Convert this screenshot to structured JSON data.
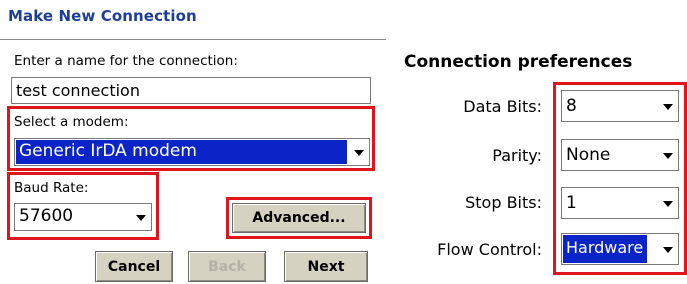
{
  "dialog": {
    "title": "Make New Connection",
    "name_prompt": "Enter a name for the connection:",
    "name_value": "test connection",
    "modem_label": "Select a modem:",
    "modem_value": "Generic IrDA modem",
    "baud_label": "Baud Rate:",
    "baud_value": "57600",
    "advanced_label": "Advanced...",
    "buttons": {
      "cancel": "Cancel",
      "back": "Back",
      "next": "Next"
    }
  },
  "preferences": {
    "title": "Connection preferences",
    "rows": [
      {
        "label": "Data Bits:",
        "value": "8"
      },
      {
        "label": "Parity:",
        "value": "None"
      },
      {
        "label": "Stop Bits:",
        "value": "1"
      },
      {
        "label": "Flow Control:",
        "value": "Hardware"
      }
    ]
  },
  "colors": {
    "title": "#1c3f94",
    "highlight_box": "#e1141b",
    "selection": "#0a24c8",
    "button_face": "#d6d2c2"
  }
}
